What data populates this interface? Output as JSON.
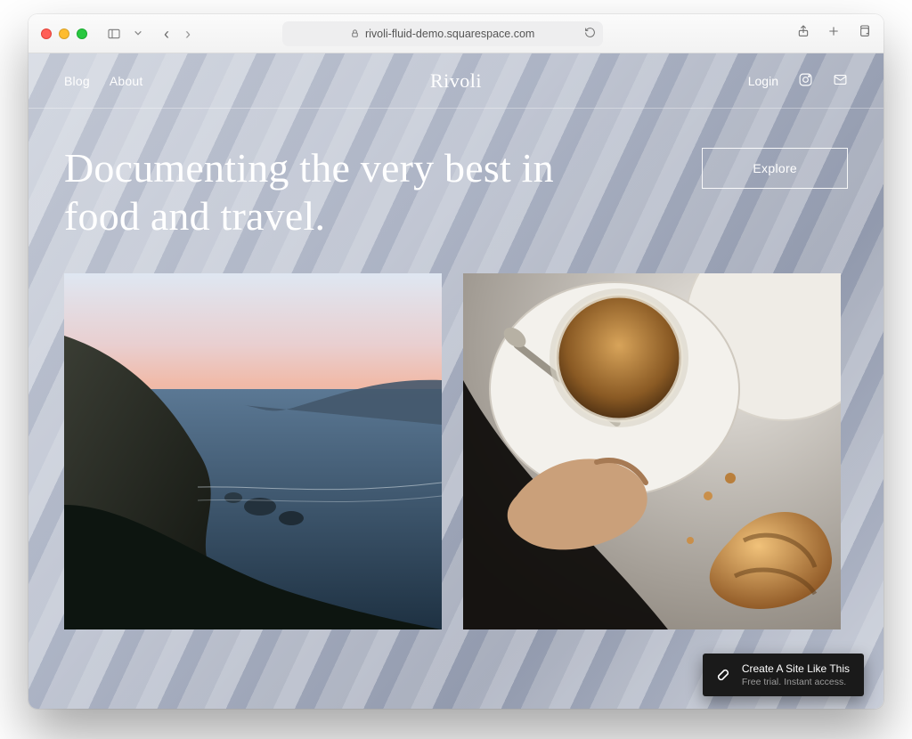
{
  "browser": {
    "url_text": "rivoli-fluid-demo.squarespace.com"
  },
  "header": {
    "nav": {
      "blog": "Blog",
      "about": "About"
    },
    "brand": "Rivoli",
    "login": "Login"
  },
  "hero": {
    "headline": "Documenting the very best in food and travel.",
    "cta": "Explore"
  },
  "promo": {
    "title": "Create A Site Like This",
    "subtitle": "Free trial. Instant access."
  }
}
